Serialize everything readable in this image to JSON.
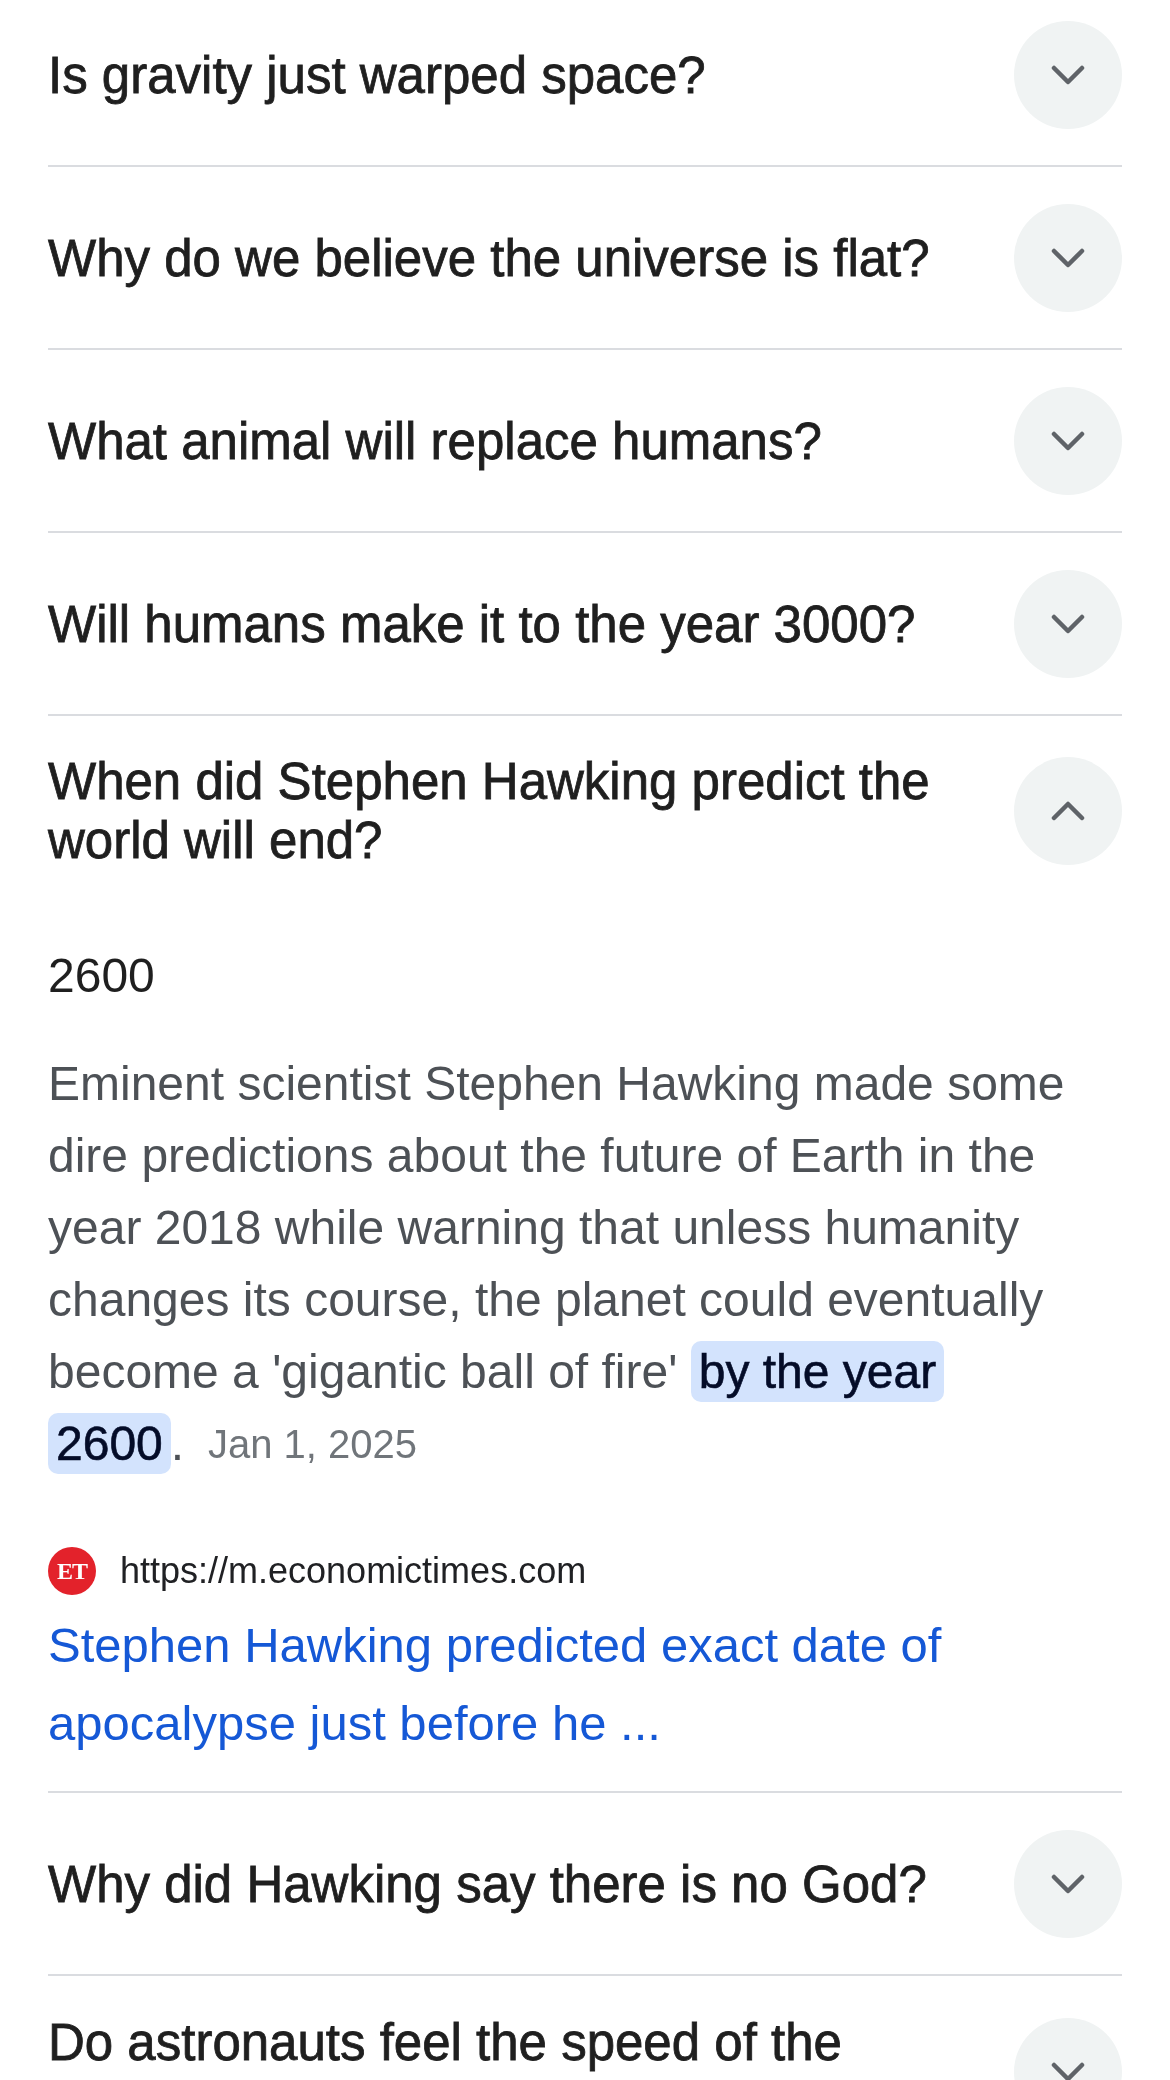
{
  "questions": [
    {
      "question": "Is gravity just warped space?",
      "expanded": false
    },
    {
      "question": "Why do we believe the universe is flat?",
      "expanded": false
    },
    {
      "question": "What animal will replace humans?",
      "expanded": false
    },
    {
      "question": "Will humans make it to the year 3000?",
      "expanded": false
    },
    {
      "question": "When did Stephen Hawking predict the world will end?",
      "expanded": true,
      "answer": {
        "short_answer": "2600",
        "snippet": "Eminent scientist Stephen Hawking made some dire predictions about the future of Earth in the year 2018 while warning that unless humanity changes its course, the planet could eventually become a 'gigantic ball of fire' **by the year 2600**.",
        "date": "Jan 1, 2025",
        "source": {
          "logo_text": "ET",
          "url": "https://m.economictimes.com",
          "title": "Stephen Hawking predicted exact date of apocalypse just before he ..."
        }
      }
    },
    {
      "question": "Why did Hawking say there is no God?",
      "expanded": false
    },
    {
      "question": "Do astronauts feel the speed of the",
      "expanded": false
    }
  ]
}
